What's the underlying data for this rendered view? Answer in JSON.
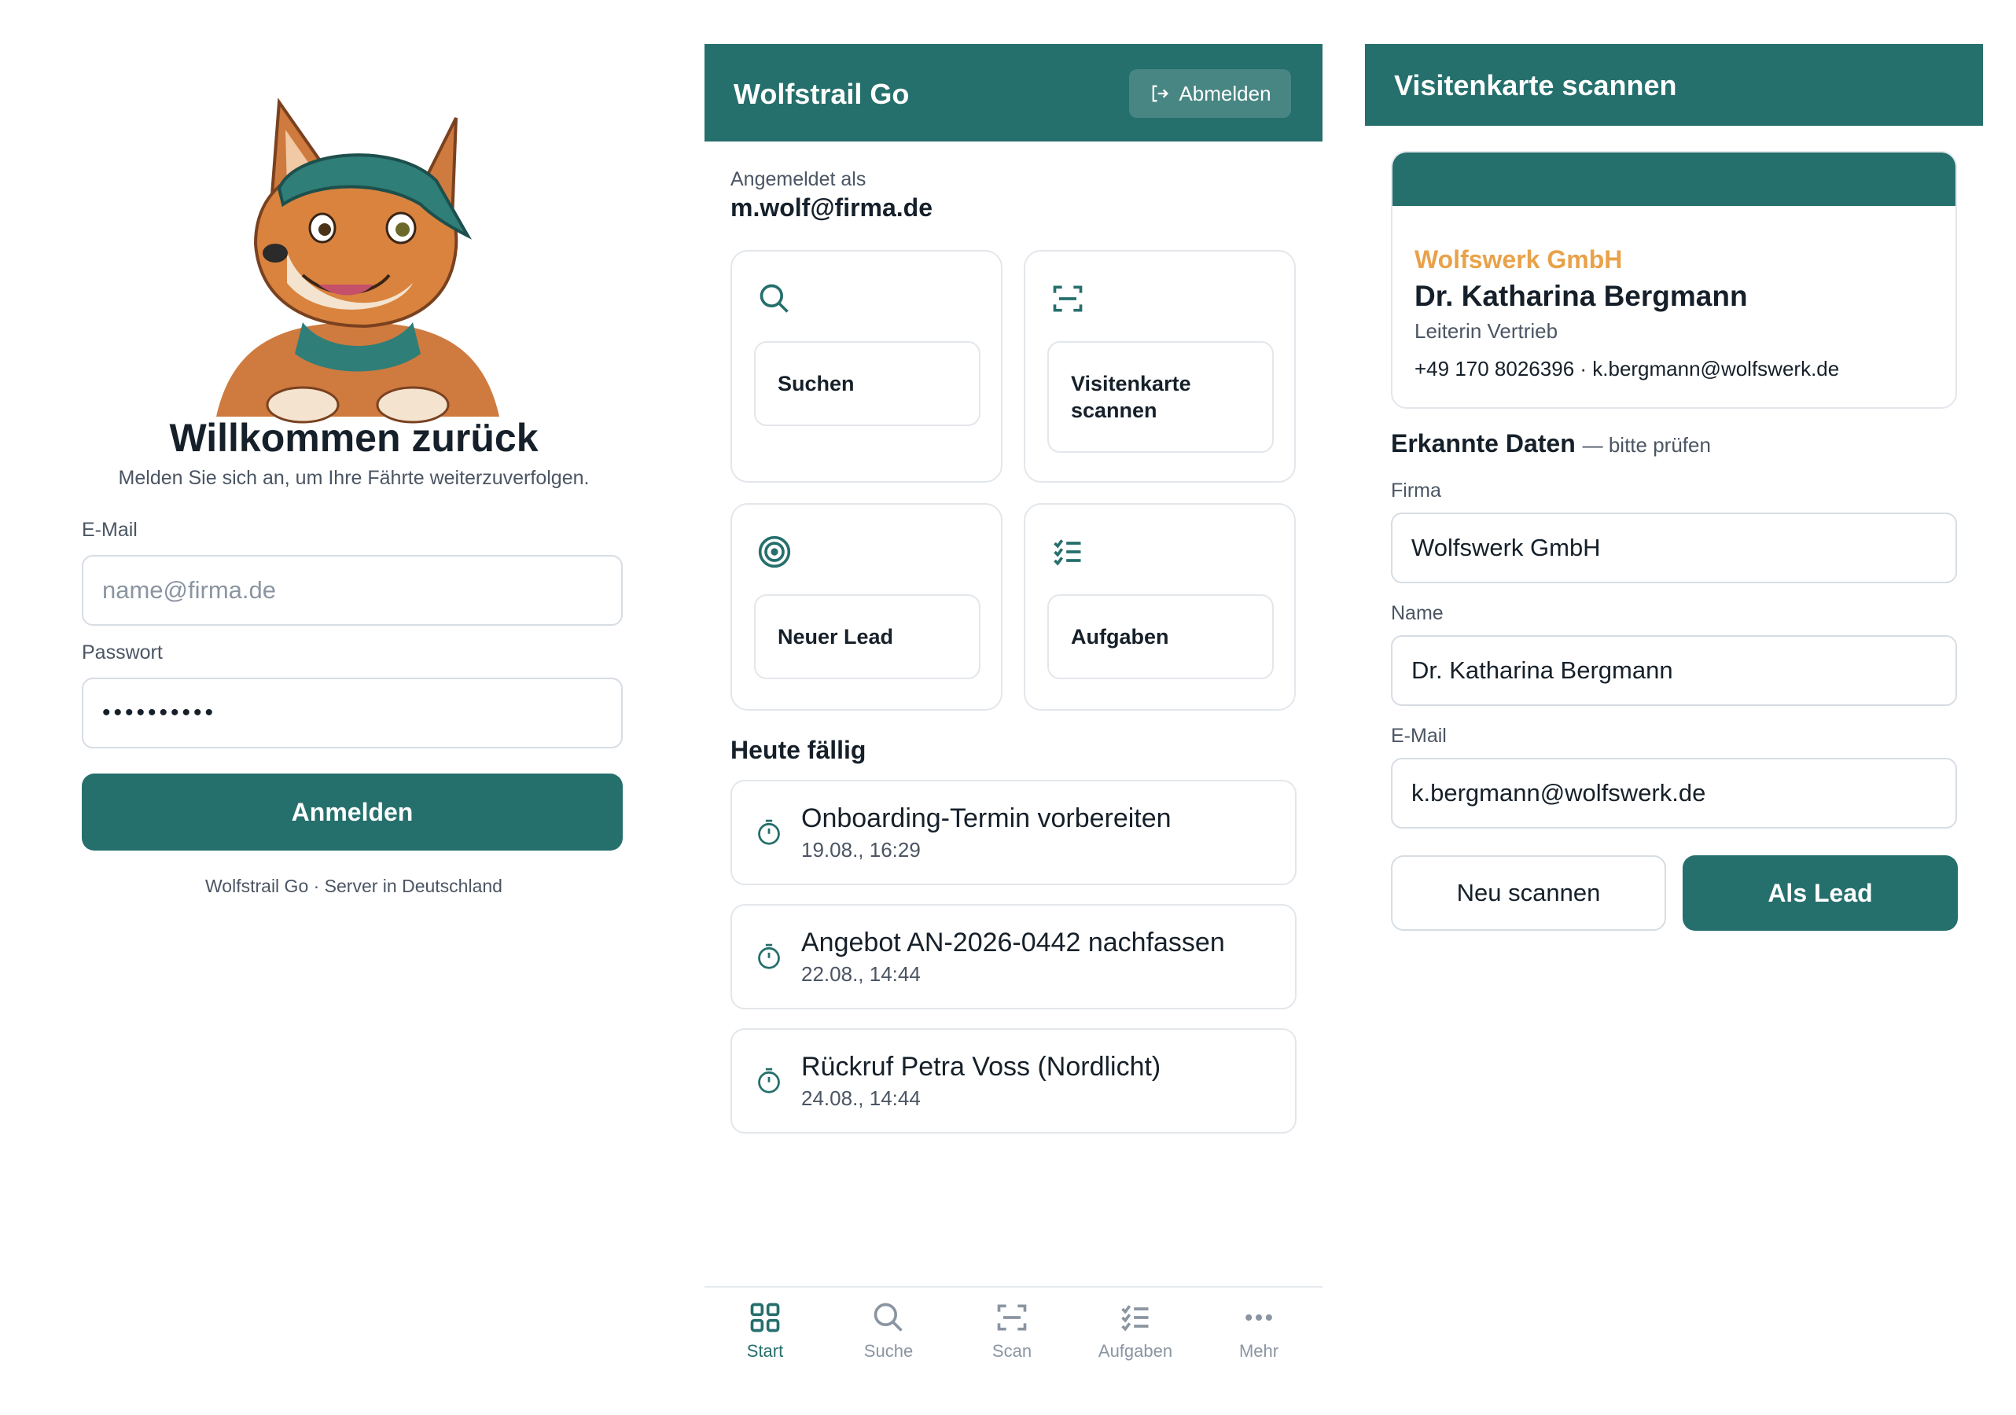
{
  "login": {
    "mascot_icon": "wolf-mascot",
    "title": "Willkommen zurück",
    "subtitle": "Melden Sie sich an, um Ihre Fährte weiterzuverfolgen.",
    "email_label": "E-Mail",
    "email_placeholder": "name@firma.de",
    "password_label": "Passwort",
    "password_value": "••••••••••",
    "submit_label": "Anmelden",
    "footer": "Wolfstrail Go · Server in Deutschland"
  },
  "home": {
    "app_title": "Wolfstrail Go",
    "logout_label": "Abmelden",
    "logged_in_label": "Angemeldet als",
    "user_email": "m.wolf@firma.de",
    "tiles": [
      {
        "label": "Suchen",
        "icon": "search-icon"
      },
      {
        "label": "Visitenkarte scannen",
        "icon": "scan-icon"
      },
      {
        "label": "Neuer Lead",
        "icon": "target-icon"
      },
      {
        "label": "Aufgaben",
        "icon": "tasks-icon"
      }
    ],
    "due_title": "Heute fällig",
    "tasks": [
      {
        "title": "Onboarding-Termin vorbereiten",
        "due": "19.08., 16:29"
      },
      {
        "title": "Angebot AN-2026-0442 nachfassen",
        "due": "22.08., 14:44"
      },
      {
        "title": "Rückruf Petra Voss (Nordlicht)",
        "due": "24.08., 14:44"
      }
    ],
    "nav": [
      {
        "label": "Start",
        "icon": "grid-icon",
        "active": true
      },
      {
        "label": "Suche",
        "icon": "search-icon",
        "active": false
      },
      {
        "label": "Scan",
        "icon": "scan-icon",
        "active": false
      },
      {
        "label": "Aufgaben",
        "icon": "tasks-icon",
        "active": false
      },
      {
        "label": "Mehr",
        "icon": "more-icon",
        "active": false
      }
    ]
  },
  "scan": {
    "title": "Visitenkarte scannen",
    "card": {
      "company": "Wolfswerk GmbH",
      "name": "Dr. Katharina Bergmann",
      "role": "Leiterin Vertrieb",
      "contact": "+49 170 8026396 · k.bergmann@wolfswerk.de"
    },
    "recognized_title": "Erkannte Daten",
    "recognized_hint": "— bitte prüfen",
    "fields": {
      "company_label": "Firma",
      "company_value": "Wolfswerk GmbH",
      "name_label": "Name",
      "name_value": "Dr. Katharina Bergmann",
      "email_label": "E-Mail",
      "email_value": "k.bergmann@wolfswerk.de"
    },
    "rescan_label": "Neu scannen",
    "lead_label": "Als Lead"
  },
  "colors": {
    "brand": "#256f6c",
    "accent": "#e9a24a",
    "text": "#16202a",
    "muted": "#4b5563",
    "border": "#e3e7eb"
  }
}
